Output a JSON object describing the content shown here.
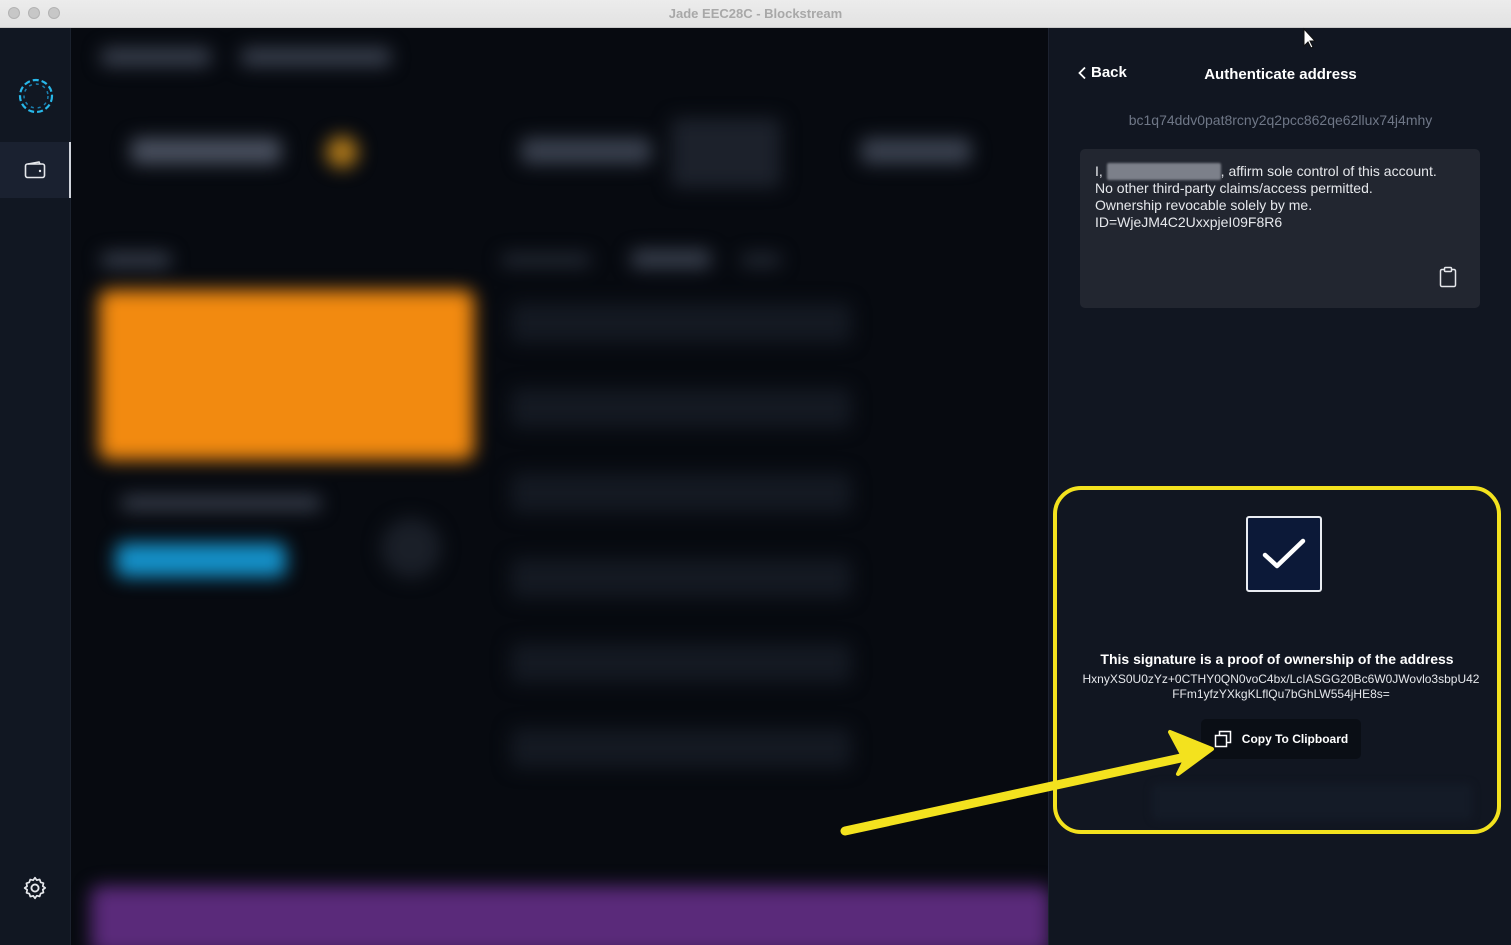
{
  "window": {
    "title": "Jade EEC28C - Blockstream"
  },
  "panel": {
    "back_label": "Back",
    "title": "Authenticate address",
    "address": "bc1q74ddv0pat8rcny2q2pcc862qe62llux74j4mhy",
    "message": {
      "prefix": "I, ",
      "suffix": ", affirm sole control of this account.",
      "line2": "No other third-party claims/access permitted.",
      "line3": "Ownership revocable solely by me.",
      "line4": "ID=WjeJM4C2UxxpjeI09F8R6"
    },
    "signature": {
      "title": "This signature is a proof of ownership of the address",
      "value": "HxnyXS0U0zYz+0CTHY0QN0voC4bx/LcIASGG20Bc6W0JWovlo3sbpU42FFm1yfzYXkgKLflQu7bGhLW554jHE8s=",
      "copy_label": "Copy To Clipboard"
    }
  },
  "icons": {
    "logo": "blockstream-logo-icon",
    "wallet": "wallet-icon",
    "settings": "gear-icon",
    "back": "chevron-left-icon",
    "clipboard": "clipboard-icon",
    "copy": "copy-icon",
    "check": "check-icon"
  },
  "colors": {
    "accent_highlight": "#f3e21e",
    "panel_bg": "#111621",
    "check_bg": "#0c1938",
    "blurred_card": "#f28a10",
    "blurred_button": "#1591c9",
    "blurred_banner": "#5a2a7a"
  }
}
